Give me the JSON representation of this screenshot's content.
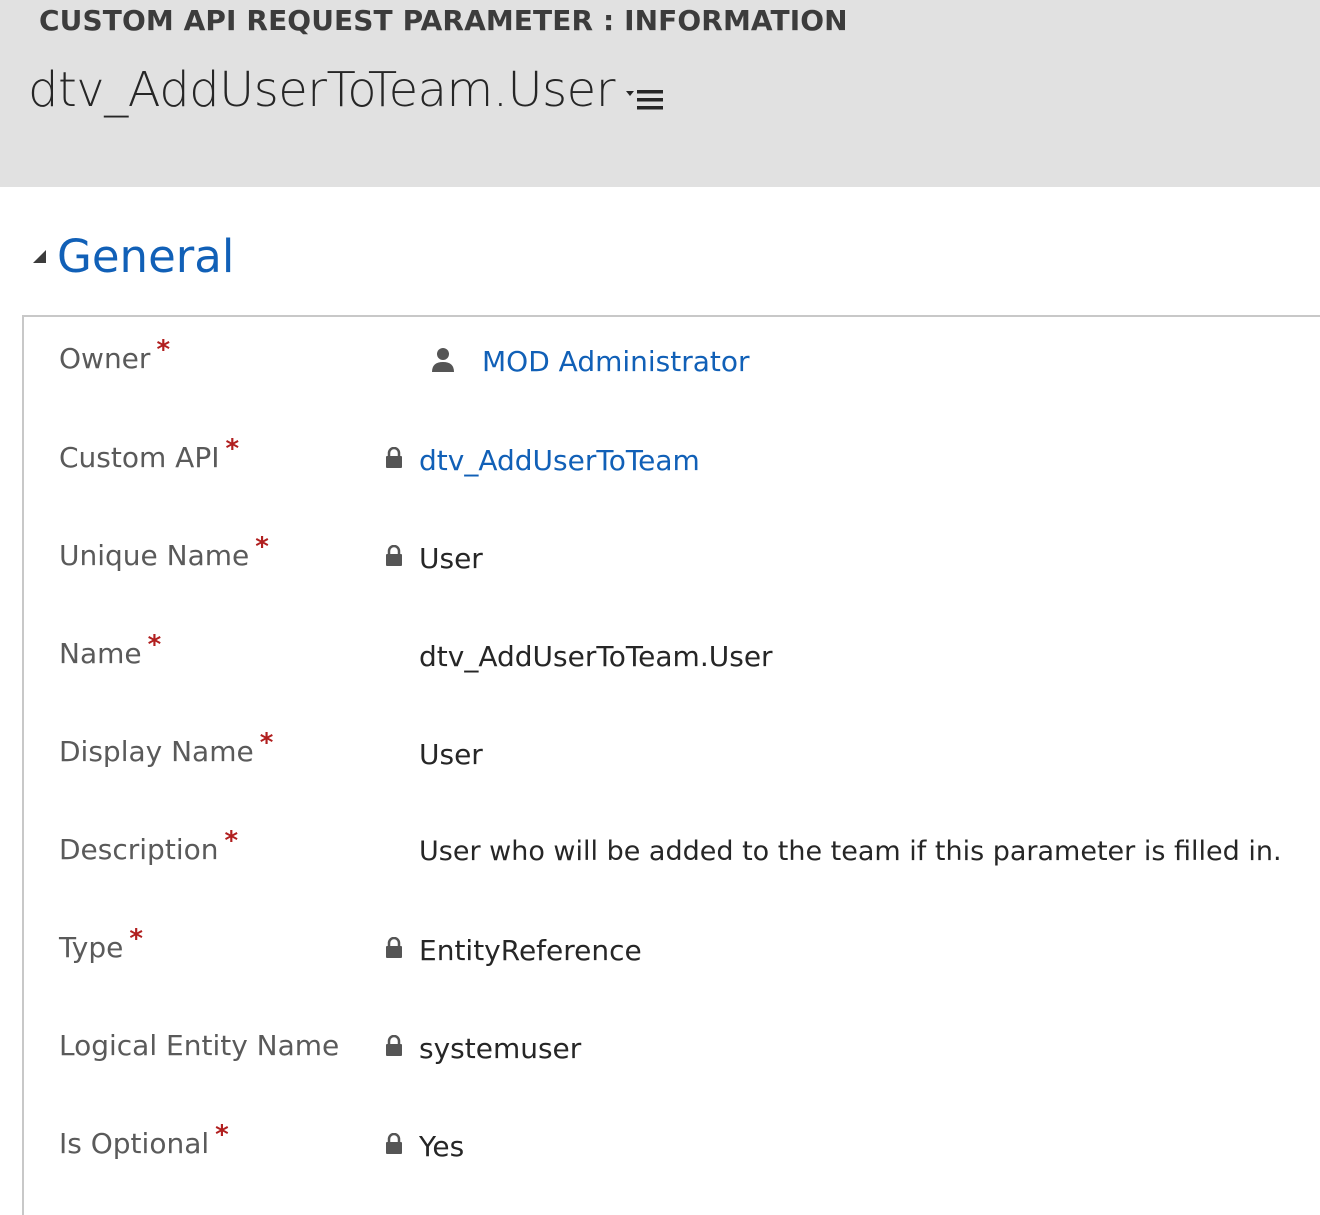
{
  "header": {
    "entity_type": "CUSTOM API REQUEST PARAMETER : INFORMATION",
    "record_title": "dtv_AddUserToTeam.User",
    "menu_icon": "form-selector-menu-icon"
  },
  "section": {
    "title": "General",
    "toggle_icon": "collapse-triangle-icon"
  },
  "fields": [
    {
      "label": "Owner",
      "required": "*",
      "value": "MOD Administrator"
    },
    {
      "label": "Custom API",
      "required": "*",
      "value": "dtv_AddUserToTeam"
    },
    {
      "label": "Unique Name",
      "required": "*",
      "value": "User"
    },
    {
      "label": "Name",
      "required": "*",
      "value": "dtv_AddUserToTeam.User"
    },
    {
      "label": "Display Name",
      "required": "*",
      "value": "User"
    },
    {
      "label": "Description",
      "required": "*",
      "value": "User who will be added to the team if this parameter is filled in."
    },
    {
      "label": "Type",
      "required": "*",
      "value": "EntityReference"
    },
    {
      "label": "Logical Entity Name",
      "value": "systemuser"
    },
    {
      "label": "Is Optional",
      "required": "*",
      "value": "Yes"
    }
  ],
  "colors": {
    "header_bg": "#e1e1e1",
    "link": "#1160b7",
    "required": "#b11f1f",
    "label": "#5a5a5a",
    "value": "#262626"
  }
}
